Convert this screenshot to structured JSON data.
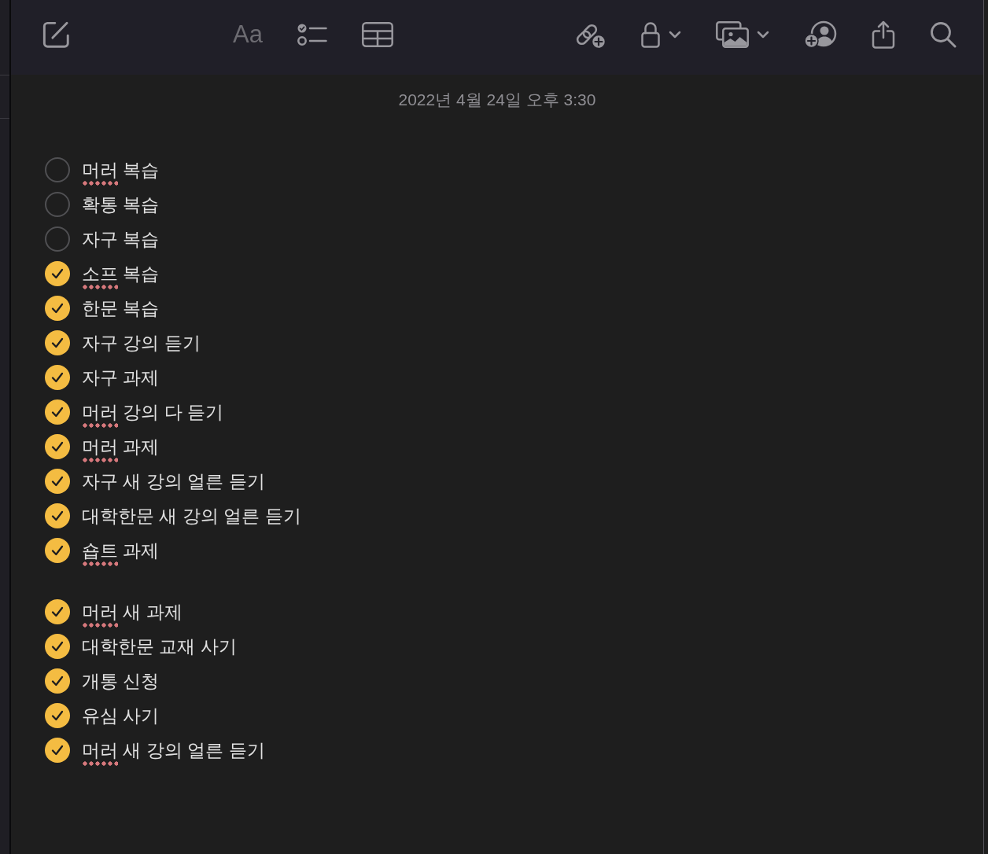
{
  "toolbar": {
    "format_label": "Aa"
  },
  "note": {
    "date": "2022년 4월 24일 오후 3:30",
    "groups": [
      {
        "items": [
          {
            "checked": false,
            "segments": [
              {
                "text": "머러",
                "misspelled": true
              },
              {
                "text": "복습",
                "misspelled": false
              }
            ]
          },
          {
            "checked": false,
            "segments": [
              {
                "text": "확통 복습",
                "misspelled": false
              }
            ]
          },
          {
            "checked": false,
            "segments": [
              {
                "text": "자구 복습",
                "misspelled": false
              }
            ]
          },
          {
            "checked": true,
            "segments": [
              {
                "text": "소프",
                "misspelled": true
              },
              {
                "text": "복습",
                "misspelled": false
              }
            ]
          },
          {
            "checked": true,
            "segments": [
              {
                "text": "한문 복습",
                "misspelled": false
              }
            ]
          },
          {
            "checked": true,
            "segments": [
              {
                "text": "자구 강의 듣기",
                "misspelled": false
              }
            ]
          },
          {
            "checked": true,
            "segments": [
              {
                "text": "자구 과제",
                "misspelled": false
              }
            ]
          },
          {
            "checked": true,
            "segments": [
              {
                "text": "머러",
                "misspelled": true
              },
              {
                "text": "강의 다 듣기",
                "misspelled": false
              }
            ]
          },
          {
            "checked": true,
            "segments": [
              {
                "text": "머러",
                "misspelled": true
              },
              {
                "text": "과제",
                "misspelled": false
              }
            ]
          },
          {
            "checked": true,
            "segments": [
              {
                "text": "자구 새 강의 얼른 듣기",
                "misspelled": false
              }
            ]
          },
          {
            "checked": true,
            "segments": [
              {
                "text": "대학한문 새 강의 얼른 듣기",
                "misspelled": false
              }
            ]
          },
          {
            "checked": true,
            "segments": [
              {
                "text": "숍트",
                "misspelled": true
              },
              {
                "text": "과제",
                "misspelled": false
              }
            ]
          }
        ]
      },
      {
        "items": [
          {
            "checked": true,
            "segments": [
              {
                "text": "머러",
                "misspelled": true
              },
              {
                "text": "새 과제",
                "misspelled": false
              }
            ]
          },
          {
            "checked": true,
            "segments": [
              {
                "text": "대학한문 교재 사기",
                "misspelled": false
              }
            ]
          },
          {
            "checked": true,
            "segments": [
              {
                "text": "개통 신청",
                "misspelled": false
              }
            ]
          },
          {
            "checked": true,
            "segments": [
              {
                "text": "유심 사기",
                "misspelled": false
              }
            ]
          },
          {
            "checked": true,
            "segments": [
              {
                "text": "머러",
                "misspelled": true
              },
              {
                "text": "새 강의 얼른 듣기",
                "misspelled": false
              }
            ]
          }
        ]
      }
    ]
  }
}
